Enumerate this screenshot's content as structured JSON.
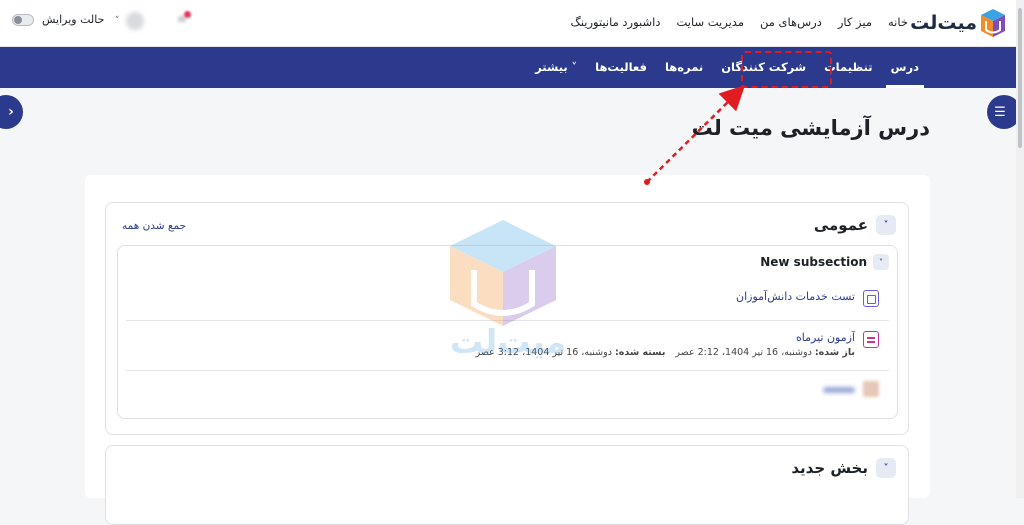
{
  "brand": {
    "name": "میت‌لت"
  },
  "top_nav": {
    "items": [
      "خانه",
      "میز کار",
      "درس‌های من",
      "مدیریت سایت",
      "داشبورد مانیتورینگ"
    ]
  },
  "edit_mode": {
    "label": "حالت ویرایش"
  },
  "course_nav": {
    "tabs": [
      "درس",
      "تنظیمات",
      "شرکت کنندگان",
      "نمره‌ها",
      "فعالیت‌ها",
      "بیشتر"
    ],
    "active": "درس",
    "highlighted": "شرکت کنندگان"
  },
  "course": {
    "title": "درس آزمایشی میت لت"
  },
  "sections": [
    {
      "title": "عمومی",
      "collapse_all": "جمع شدن همه",
      "subsection": {
        "title": "New subsection",
        "activities": [
          {
            "type": "page",
            "name": "تست خدمات دانش‌آموزان"
          },
          {
            "type": "quiz",
            "name": "آزمون تیرماه",
            "opened_label": "باز شده:",
            "opened_value": "دوشنبه، 16 تیر 1404، 2:12 عصر",
            "closes_label": "بسته شده:",
            "closes_value": "دوشنبه، 16 تیر 1404، 3:12 عصر"
          }
        ]
      }
    },
    {
      "title": "بخش جدید"
    }
  ],
  "colors": {
    "primary": "#2b3a8c",
    "highlight": "#e11b22",
    "background": "#f5f6f8"
  },
  "icons": {
    "drawer_left": "chevron-right-icon",
    "drawer_right": "list-icon",
    "section_toggle": "chevron-down-icon",
    "notification": "bell-icon"
  },
  "watermark": {
    "text": "میت‌لت"
  }
}
